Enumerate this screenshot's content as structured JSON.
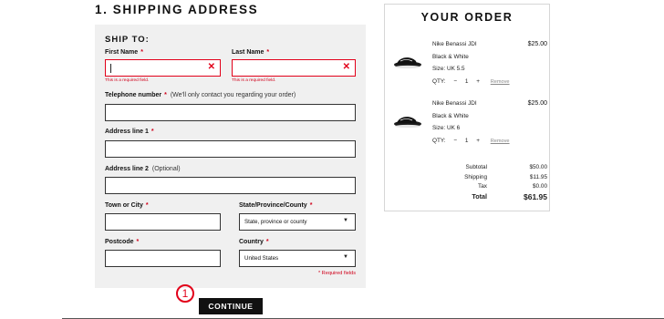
{
  "checkout": {
    "section_title": "1. SHIPPING ADDRESS",
    "ship_to": "SHIP TO:",
    "required_marker": "*",
    "required_note": "* Required fields",
    "continue_label": "CONTINUE",
    "step_marker": "1",
    "fields": {
      "first_name": {
        "label": "First Name",
        "value": "",
        "error": "This is a required field."
      },
      "last_name": {
        "label": "Last Name",
        "value": "",
        "error": "This is a required field."
      },
      "telephone": {
        "label": "Telephone number",
        "note": "(We'll only contact you regarding your order)",
        "value": ""
      },
      "address1": {
        "label": "Address line 1",
        "value": ""
      },
      "address2": {
        "label": "Address line 2",
        "note": "(Optional)",
        "value": ""
      },
      "town": {
        "label": "Town or City",
        "value": ""
      },
      "state": {
        "label": "State/Province/County",
        "selected": "State, province or county"
      },
      "postcode": {
        "label": "Postcode",
        "value": ""
      },
      "country": {
        "label": "Country",
        "selected": "United States"
      }
    }
  },
  "order": {
    "title": "YOUR ORDER",
    "qty_label": "QTY:",
    "minus": "−",
    "plus": "+",
    "remove_label": "Remove",
    "items": [
      {
        "name": "Nike Benassi JDI",
        "color": "Black & White",
        "size": "Size:  UK 5.5",
        "qty": "1",
        "price": "$25.00"
      },
      {
        "name": "Nike Benassi JDI",
        "color": "Black & White",
        "size": "Size:  UK 6",
        "qty": "1",
        "price": "$25.00"
      }
    ],
    "totals": {
      "subtotal_label": "Subtotal",
      "subtotal": "$50.00",
      "shipping_label": "Shipping",
      "shipping": "$11.95",
      "tax_label": "Tax",
      "tax": "$0.00",
      "total_label": "Total",
      "total": "$61.95"
    }
  },
  "colors": {
    "error": "#e2001a",
    "panel": "#f0f0f0",
    "button": "#111111"
  },
  "icons": {
    "error_clear": "close-icon",
    "select_arrow": "caret-down-icon",
    "product": "slide-sandal-image"
  }
}
